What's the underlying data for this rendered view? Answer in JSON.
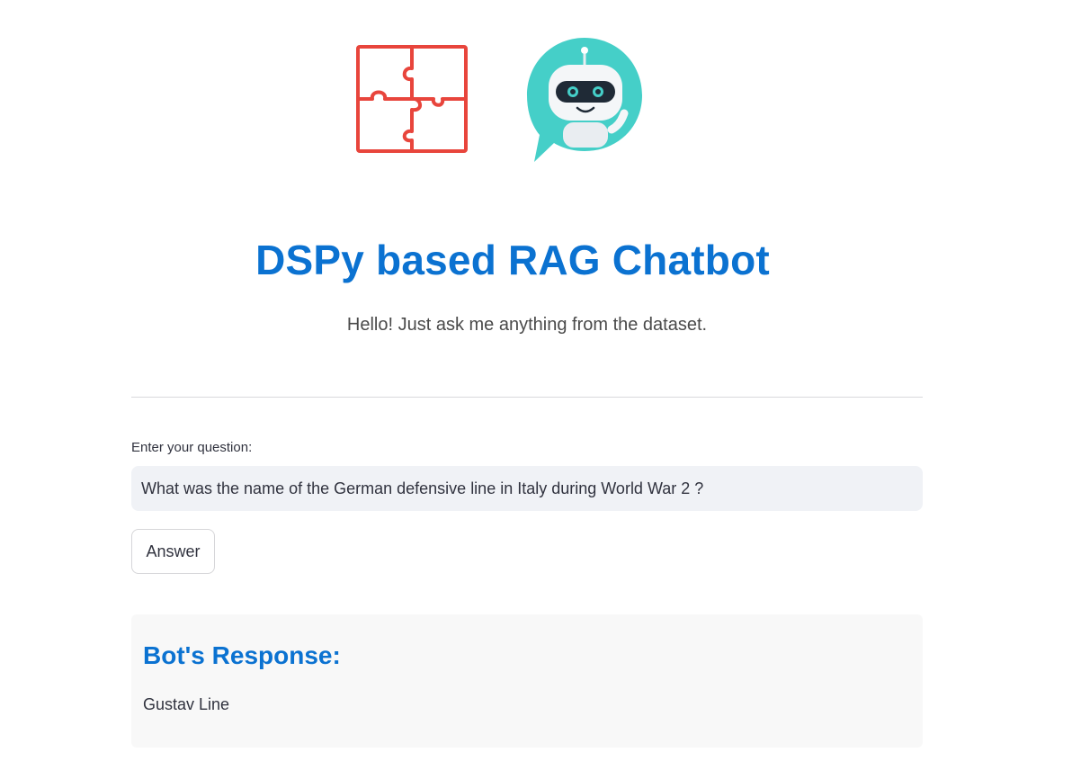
{
  "header": {
    "title": "DSPy based RAG Chatbot",
    "subtitle": "Hello! Just ask me anything from the dataset.",
    "logos": [
      "puzzle-icon",
      "robot-chat-icon"
    ]
  },
  "form": {
    "question_label": "Enter your question:",
    "question_value": "What was the name of the German defensive line in Italy during World War 2 ?",
    "submit_label": "Answer"
  },
  "response": {
    "heading": "Bot's Response:",
    "text": "Gustav Line"
  },
  "colors": {
    "accent": "#0b72d1",
    "puzzle": "#e8453c",
    "robot_bubble": "#45cfc8"
  }
}
